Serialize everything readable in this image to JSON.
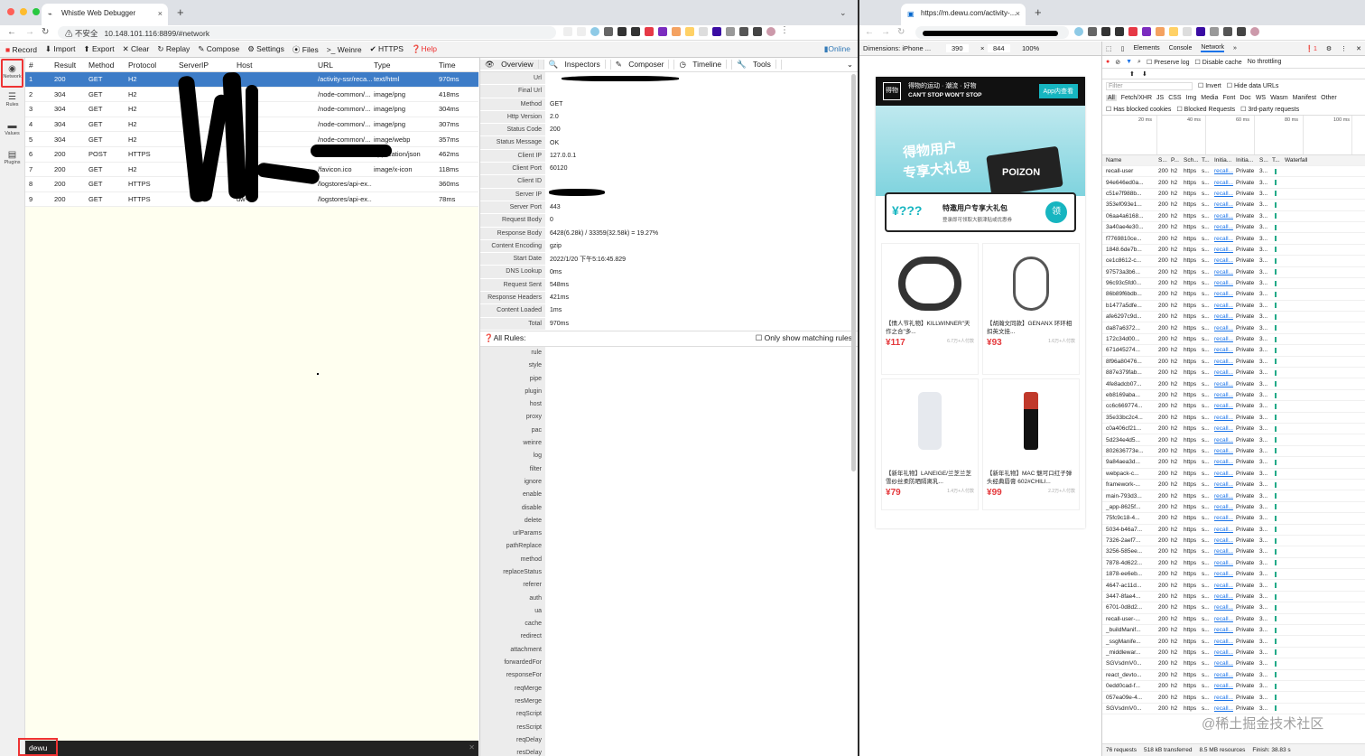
{
  "left_browser": {
    "tab_title": "Whistle Web Debugger",
    "address_insecure": "不安全",
    "address_url": "10.148.101.116:8899/#network"
  },
  "toolbar": {
    "record": "Record",
    "import": "Import",
    "export": "Export",
    "clear": "Clear",
    "replay": "Replay",
    "compose": "Compose",
    "settings": "Settings",
    "files": "Files",
    "weinre": "Weinre",
    "https": "HTTPS",
    "help": "Help",
    "online": "Online"
  },
  "sidebar": [
    {
      "label": "Network",
      "icon": "globe-icon"
    },
    {
      "label": "Rules",
      "icon": "list-icon"
    },
    {
      "label": "Values",
      "icon": "folder-icon"
    },
    {
      "label": "Plugins",
      "icon": "plug-icon"
    }
  ],
  "network_columns": [
    "#",
    "Result",
    "Method",
    "Protocol",
    "ServerIP",
    "Host",
    "URL",
    "Type",
    "Time"
  ],
  "network_rows": [
    {
      "n": "1",
      "result": "200",
      "method": "GET",
      "protocol": "H2",
      "host": "",
      "url": "/activity-ssr/reca...",
      "type": "text/html",
      "time": "970ms"
    },
    {
      "n": "2",
      "result": "304",
      "method": "GET",
      "protocol": "H2",
      "host": "",
      "url": "/node-common/...",
      "type": "image/png",
      "time": "418ms"
    },
    {
      "n": "3",
      "result": "304",
      "method": "GET",
      "protocol": "H2",
      "host": "",
      "url": "/node-common/...",
      "type": "image/png",
      "time": "304ms"
    },
    {
      "n": "4",
      "result": "304",
      "method": "GET",
      "protocol": "H2",
      "host": "",
      "url": "/node-common/...",
      "type": "image/png",
      "time": "307ms"
    },
    {
      "n": "5",
      "result": "304",
      "method": "GET",
      "protocol": "H2",
      "host": "",
      "url": "/node-common/...",
      "type": "image/webp",
      "time": "357ms"
    },
    {
      "n": "6",
      "result": "200",
      "method": "POST",
      "protocol": "HTTPS",
      "host": "",
      "url": "",
      "type": "application/json",
      "time": "462ms"
    },
    {
      "n": "7",
      "result": "200",
      "method": "GET",
      "protocol": "H2",
      "host": "",
      "url": "/favicon.ico",
      "type": "image/x-icon",
      "time": "118ms"
    },
    {
      "n": "8",
      "result": "200",
      "method": "GET",
      "protocol": "HTTPS",
      "host": "dw...",
      "url": "/logstores/api-ex...",
      "type": "",
      "time": "360ms"
    },
    {
      "n": "9",
      "result": "200",
      "method": "GET",
      "protocol": "HTTPS",
      "host": "dw-",
      "url": "/logstores/api-ex...",
      "type": "",
      "time": "78ms"
    }
  ],
  "filter_value": "dewu",
  "detail_tabs": [
    "Overview",
    "Inspectors",
    "Composer",
    "Timeline",
    "Tools"
  ],
  "overview": [
    {
      "k": "Url",
      "v": ""
    },
    {
      "k": "Final Url",
      "v": ""
    },
    {
      "k": "Method",
      "v": "GET"
    },
    {
      "k": "Http Version",
      "v": "2.0"
    },
    {
      "k": "Status Code",
      "v": "200"
    },
    {
      "k": "Status Message",
      "v": "OK"
    },
    {
      "k": "Client IP",
      "v": "127.0.0.1"
    },
    {
      "k": "Client Port",
      "v": "60120"
    },
    {
      "k": "Client ID",
      "v": ""
    },
    {
      "k": "Server IP",
      "v": ""
    },
    {
      "k": "Server Port",
      "v": "443"
    },
    {
      "k": "Request Body",
      "v": "0"
    },
    {
      "k": "Response Body",
      "v": "6428(6.28k) / 33359(32.58k) = 19.27%"
    },
    {
      "k": "Content Encoding",
      "v": "gzip"
    },
    {
      "k": "Start Date",
      "v": "2022/1/20 下午5:16:45.829"
    },
    {
      "k": "DNS Lookup",
      "v": "0ms"
    },
    {
      "k": "Request Sent",
      "v": "548ms"
    },
    {
      "k": "Response Headers",
      "v": "421ms"
    },
    {
      "k": "Content Loaded",
      "v": "1ms"
    },
    {
      "k": "Total",
      "v": "970ms"
    }
  ],
  "rules_header": "All Rules:",
  "only_matching": "Only show matching rules",
  "rules": [
    "rule",
    "style",
    "pipe",
    "plugin",
    "host",
    "proxy",
    "pac",
    "weinre",
    "log",
    "filter",
    "ignore",
    "enable",
    "disable",
    "delete",
    "urlParams",
    "pathReplace",
    "method",
    "replaceStatus",
    "referer",
    "auth",
    "ua",
    "cache",
    "redirect",
    "attachment",
    "forwardedFor",
    "responseFor",
    "reqMerge",
    "resMerge",
    "reqScript",
    "resScript",
    "reqDelay",
    "resDelay"
  ],
  "right_browser": {
    "tab_title": "https://m.dewu.com/activity-...",
    "dimensions": "Dimensions: iPhone ...",
    "width": "390",
    "height": "844",
    "zoom": "100%"
  },
  "devtools": {
    "tabs": [
      "Elements",
      "Console",
      "Network"
    ],
    "preserve": "Preserve log",
    "disable_cache": "Disable cache",
    "throttle": "No throttling",
    "filter_ph": "Filter",
    "invert": "Invert",
    "hide_data": "Hide data URLs",
    "types": [
      "All",
      "Fetch/XHR",
      "JS",
      "CSS",
      "Img",
      "Media",
      "Font",
      "Doc",
      "WS",
      "Wasm",
      "Manifest",
      "Other"
    ],
    "blocked_cookies": "Has blocked cookies",
    "blocked_req": "Blocked Requests",
    "third_party": "3rd-party requests",
    "ticks": [
      "20 ms",
      "40 ms",
      "60 ms",
      "80 ms",
      "100 ms"
    ],
    "cols": [
      "Name",
      "S...",
      "P...",
      "Sch...",
      "T...",
      "Initia...",
      "Initia...",
      "S...",
      "T...",
      "Waterfall"
    ],
    "status": "76 requests",
    "transferred": "518 kB transferred",
    "resources": "8.5 MB resources",
    "finish": "Finish: 38.83 s"
  },
  "dev_rows": [
    "recall-user",
    "94e646ed0a...",
    "c51e7f988b...",
    "353ef093e1...",
    "06aa4a6168...",
    "3a40ae4e30...",
    "f7769810ce...",
    "1848.6de7b...",
    "ce1c8612-c...",
    "97573a3b6...",
    "96c93c5fd0...",
    "86b89f6bdb...",
    "b1477a5dfe...",
    "afe6297c9d...",
    "da87a6372...",
    "172c34d00...",
    "671d45274...",
    "8f96a80476...",
    "887e379fab...",
    "4fe8adcb07...",
    "eb8169aba...",
    "cc6c669774...",
    "35e33bc2c4...",
    "c0a406cf21...",
    "5d234e4d5...",
    "802636773e...",
    "9a84aea3d...",
    "webpack-c...",
    "framework-...",
    "main-793d3...",
    "_app-8625f...",
    "75fc9c18-4...",
    "5034-b46a7...",
    "7326-2aef7...",
    "3256-585ee...",
    "7878-4d622...",
    "1878-ee6eb...",
    "4647-ac11d...",
    "3447-8fae4...",
    "6701-0d8d2...",
    "recall-user-...",
    "_buildManif...",
    "_ssgManife...",
    "_middlewar...",
    "SGVsdmV0...",
    "react_devto...",
    "0edd0cad-f...",
    "057ea09e-4...",
    "SGVsdmV0..."
  ],
  "phone": {
    "banner_title": "得物的运动 · 潮流 · 好物",
    "banner_sub": "CAN'T STOP WON'T STOP",
    "open_app": "App内查看",
    "hero_line1": "得物用户",
    "hero_line2": "专享大礼包",
    "hero_brand": "POIZON",
    "special": "特邀用户专享大礼包",
    "special_sub": "登录即可领取大额津贴或优惠券",
    "claim": "领",
    "p1_name": "【情人节礼物】KILLWINNER\"天作之合\"多...",
    "p1_price": "117",
    "p1_sold": "6.7万+人付款",
    "p2_name": "【胡瀚文同款】GENANX 环环相扣英文挂...",
    "p2_price": "93",
    "p2_sold": "1.6万+人付款",
    "p3_name": "【新年礼物】LANEIGE/兰芝兰芝雪纱丝柔防晒隔离乳...",
    "p3_price": "79",
    "p3_sold": "1.4万+人付款",
    "p4_name": "【新年礼物】MAC 魅可口红子弹头经典唇膏 602#CHILI...",
    "p4_price": "99",
    "p4_sold": "2.2万+人付款"
  },
  "watermark": "@稀土掘金技术社区",
  "colors": {
    "selected_row": "#3d7cc7",
    "list_bg": "#fffff0",
    "accent_red": "#e33"
  }
}
